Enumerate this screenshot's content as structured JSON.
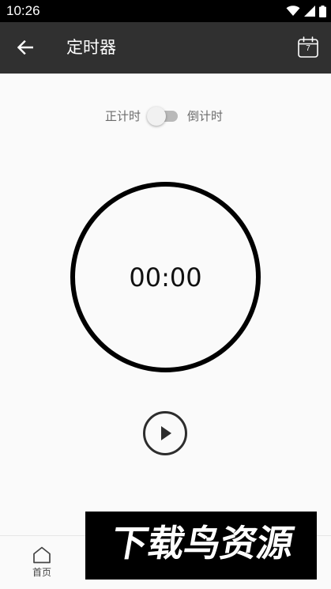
{
  "status_bar": {
    "time": "10:26",
    "icons": [
      "wifi-icon",
      "signal-icon",
      "battery-icon"
    ]
  },
  "app_bar": {
    "title": "定时器",
    "back_icon": "arrow-left-icon",
    "calendar_icon": "calendar-icon",
    "calendar_day": "7"
  },
  "mode_toggle": {
    "label_count_up": "正计时",
    "label_count_down": "倒计时",
    "checked": false
  },
  "timer": {
    "display": "00:00"
  },
  "controls": {
    "play_icon": "play-icon"
  },
  "bottom_nav": {
    "home_label": "首页",
    "home_icon": "home-icon"
  },
  "watermark": {
    "text": "下载鸟资源"
  },
  "colors": {
    "status_bar": "#000000",
    "app_bar": "#303030",
    "background": "#fafafa",
    "ring": "#000000",
    "switch_track": "#b9b9b9",
    "switch_thumb": "#f1f1f1"
  }
}
